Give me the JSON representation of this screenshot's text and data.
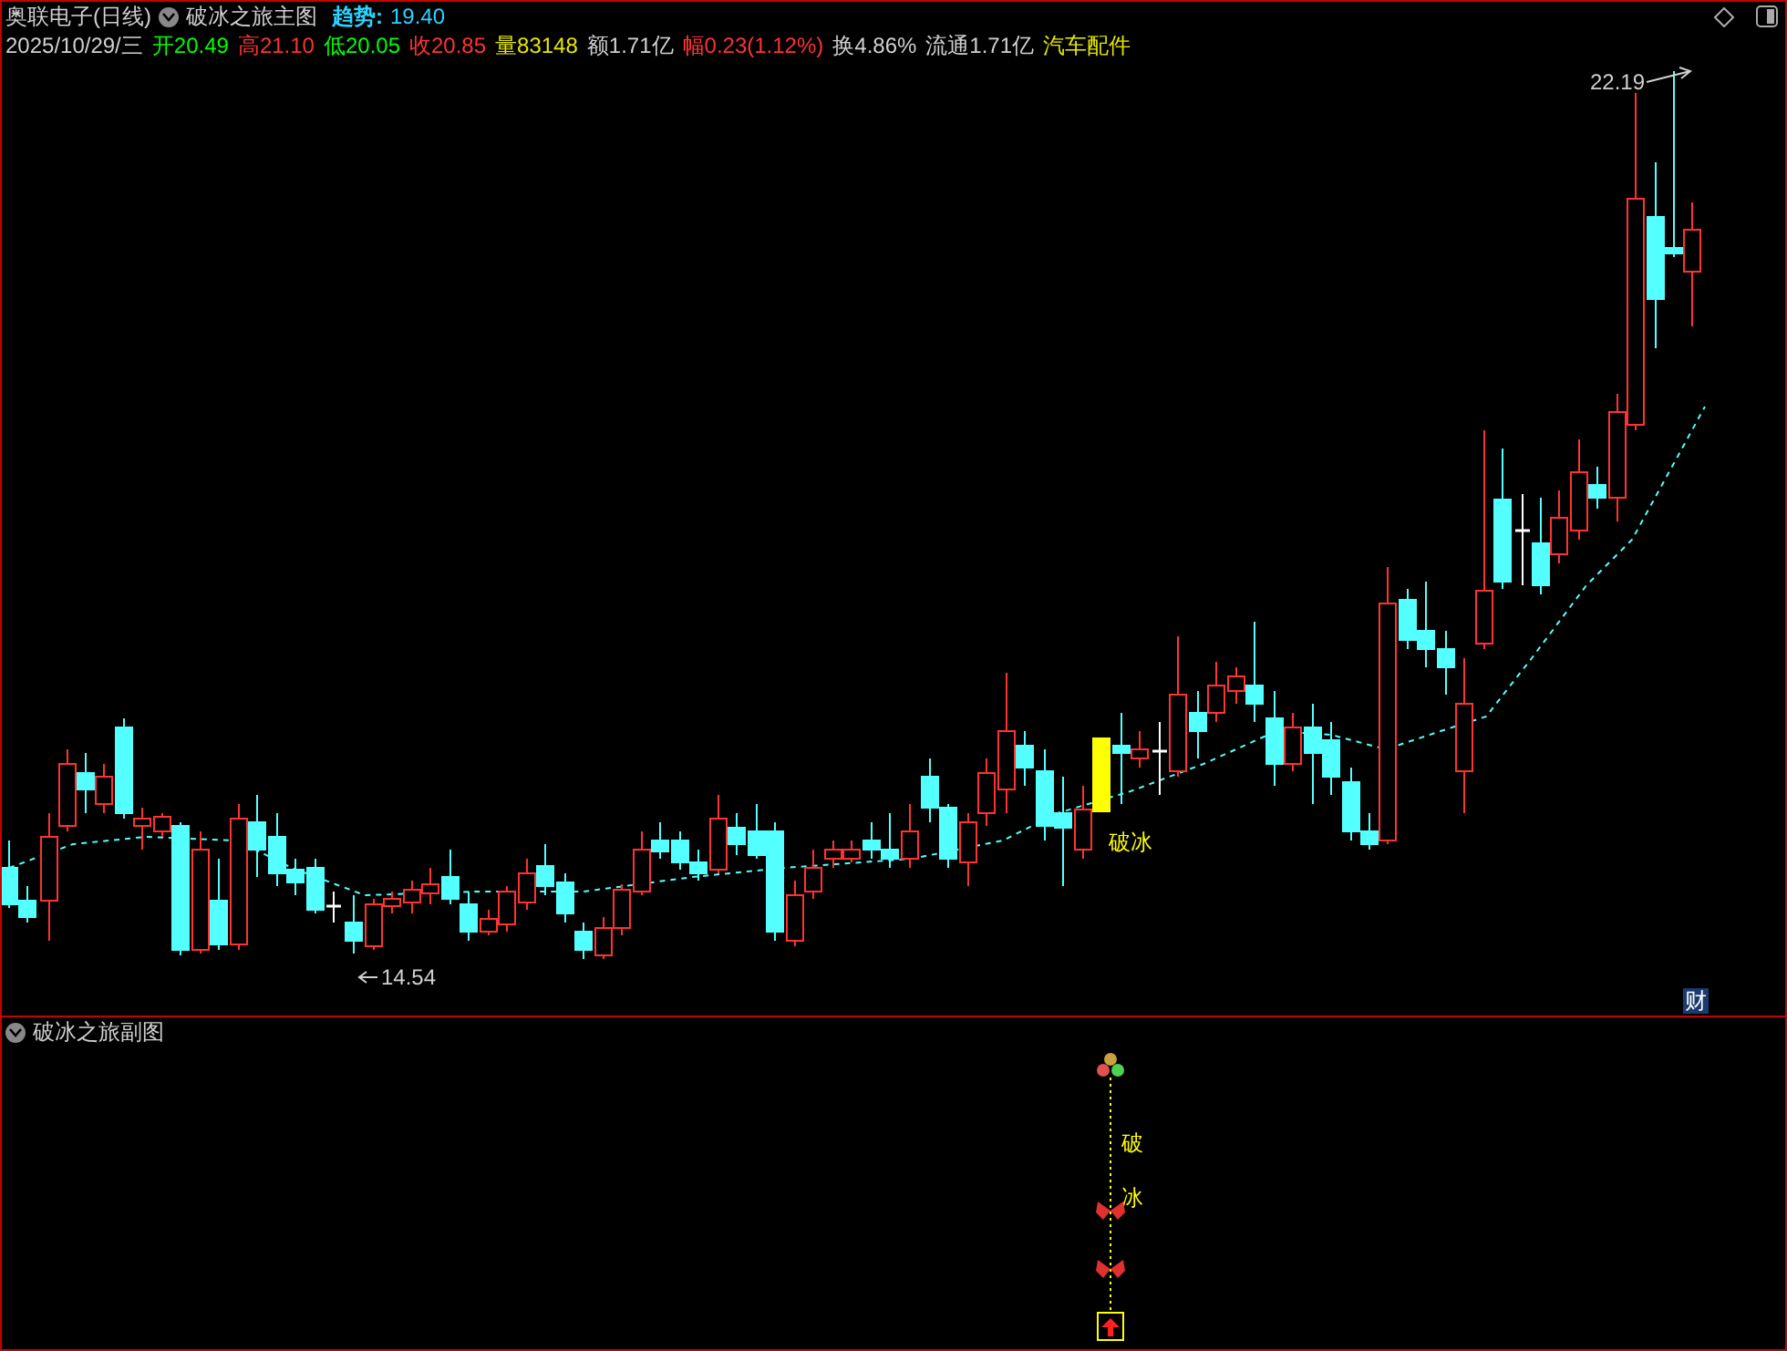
{
  "header": {
    "stock_name": "奥联电子(日线)",
    "indicator_name": "破冰之旅主图",
    "trend_label": "趋势:",
    "trend_value": "19.40"
  },
  "quote": {
    "date": "2025/10/29/三",
    "items": [
      {
        "label": "开",
        "value": "20.49",
        "color": "#00ff00"
      },
      {
        "label": "高",
        "value": "21.10",
        "color": "#ff3232"
      },
      {
        "label": "低",
        "value": "20.05",
        "color": "#00ff00"
      },
      {
        "label": "收",
        "value": "20.85",
        "color": "#ff3232"
      },
      {
        "label": "量",
        "value": "83148",
        "color": "#e6e600"
      },
      {
        "label": "额",
        "value": "1.71亿",
        "color": "#d0d0d0"
      },
      {
        "label": "幅",
        "value": "0.23(1.12%)",
        "color": "#ff3232"
      },
      {
        "label": "换",
        "value": "4.86%",
        "color": "#d0d0d0"
      },
      {
        "label": "流通",
        "value": "1.71亿",
        "color": "#d0d0d0"
      }
    ],
    "sector": "汽车配件"
  },
  "main_chart": {
    "high_label": "22.19",
    "low_label": "14.54",
    "signal_label": "破冰",
    "badge": "财"
  },
  "sub_panel": {
    "title": "破冰之旅副图",
    "signal_chars": [
      "破",
      "冰"
    ]
  }
}
